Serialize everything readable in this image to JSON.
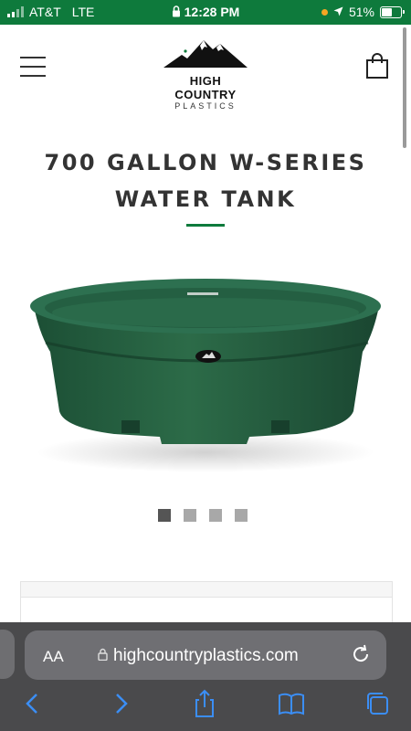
{
  "status_bar": {
    "carrier": "AT&T",
    "network": "LTE",
    "time": "12:28 PM",
    "battery": "51%"
  },
  "brand": {
    "name": "HIGH COUNTRY",
    "sub": "PLASTICS"
  },
  "product": {
    "title_line1": "700 GALLON W-SERIES",
    "title_line2": "WATER TANK",
    "accent_color": "#0e7a3c",
    "image_alt": "green stock water tank",
    "carousel": {
      "count": 4,
      "active_index": 0
    }
  },
  "browser": {
    "aa_label": "AA",
    "url": "highcountryplastics.com"
  },
  "icons": [
    "signal-icon",
    "lock-icon",
    "location-icon",
    "battery-icon",
    "menu-icon",
    "shopping-bag-icon",
    "reload-icon",
    "back-icon",
    "forward-icon",
    "share-icon",
    "bookmarks-icon",
    "tabs-icon"
  ]
}
